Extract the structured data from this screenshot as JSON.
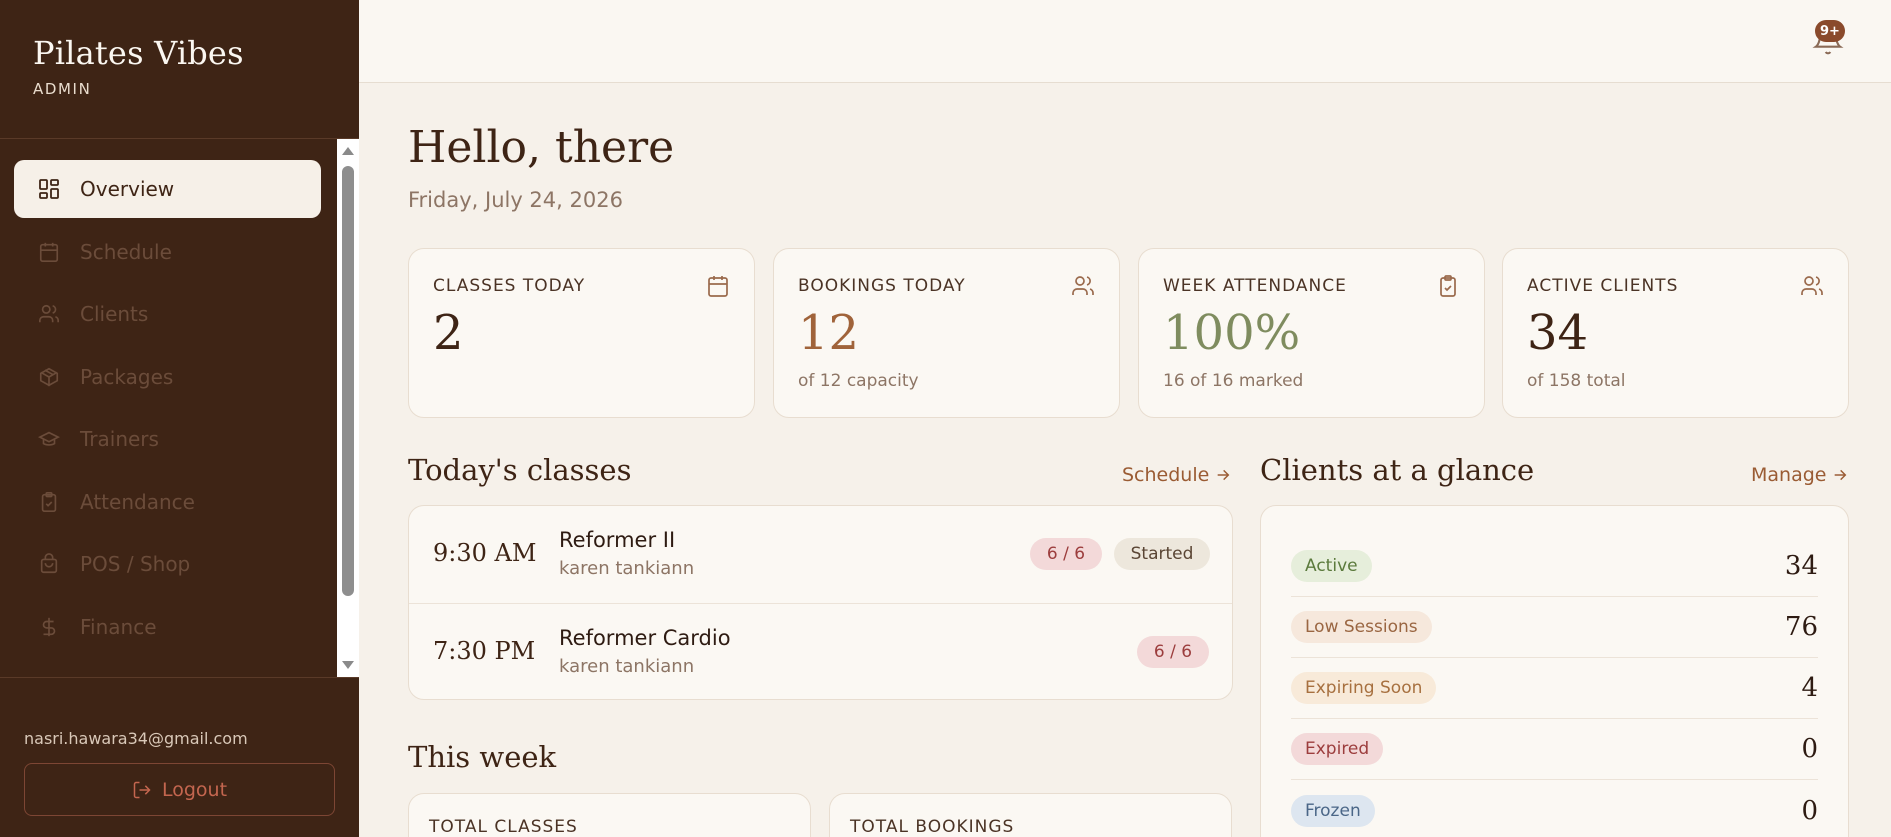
{
  "brand": {
    "name": "Pilates Vibes",
    "role": "ADMIN"
  },
  "nav": [
    {
      "label": "Overview",
      "icon": "grid-icon",
      "active": true
    },
    {
      "label": "Schedule",
      "icon": "calendar-icon",
      "active": false
    },
    {
      "label": "Clients",
      "icon": "users-icon",
      "active": false
    },
    {
      "label": "Packages",
      "icon": "package-icon",
      "active": false
    },
    {
      "label": "Trainers",
      "icon": "graduation-cap-icon",
      "active": false
    },
    {
      "label": "Attendance",
      "icon": "clipboard-check-icon",
      "active": false
    },
    {
      "label": "POS / Shop",
      "icon": "shopping-bag-icon",
      "active": false
    },
    {
      "label": "Finance",
      "icon": "dollar-icon",
      "active": false
    }
  ],
  "user": {
    "email": "nasri.hawara34@gmail.com",
    "logout_label": "Logout"
  },
  "notifications": {
    "badge": "9+"
  },
  "header": {
    "greeting": "Hello, there",
    "date": "Friday, July 24, 2026"
  },
  "stats": [
    {
      "label": "CLASSES TODAY",
      "value": "2",
      "sub": "",
      "icon": "calendar-icon",
      "color": "#3e2415"
    },
    {
      "label": "BOOKINGS TODAY",
      "value": "12",
      "sub": "of 12 capacity",
      "icon": "users-icon",
      "color": "#a0633a"
    },
    {
      "label": "WEEK ATTENDANCE",
      "value": "100%",
      "sub": "16 of 16 marked",
      "icon": "clipboard-check-icon",
      "color": "#7f8c5f"
    },
    {
      "label": "ACTIVE CLIENTS",
      "value": "34",
      "sub": "of 158 total",
      "icon": "users-icon",
      "color": "#3e2415"
    }
  ],
  "today_classes": {
    "title": "Today's classes",
    "link": "Schedule",
    "items": [
      {
        "time": "9:30 AM",
        "name": "Reformer II",
        "trainer": "karen tankiann",
        "capacity": "6 / 6",
        "status": "Started"
      },
      {
        "time": "7:30 PM",
        "name": "Reformer Cardio",
        "trainer": "karen tankiann",
        "capacity": "6 / 6",
        "status": ""
      }
    ]
  },
  "glance": {
    "title": "Clients at a glance",
    "link": "Manage",
    "items": [
      {
        "label": "Active",
        "value": "34",
        "bg": "#e6eedb",
        "fg": "#5b7a3c"
      },
      {
        "label": "Low Sessions",
        "value": "76",
        "bg": "#f6e8dc",
        "fg": "#9a6642"
      },
      {
        "label": "Expiring Soon",
        "value": "4",
        "bg": "#f8ead9",
        "fg": "#a7703f"
      },
      {
        "label": "Expired",
        "value": "0",
        "bg": "#f3d9d9",
        "fg": "#9c3d3d"
      },
      {
        "label": "Frozen",
        "value": "0",
        "bg": "#dde6f0",
        "fg": "#4a6687"
      }
    ]
  },
  "this_week": {
    "title": "This week",
    "cards": [
      {
        "label": "TOTAL CLASSES"
      },
      {
        "label": "TOTAL BOOKINGS"
      }
    ]
  }
}
